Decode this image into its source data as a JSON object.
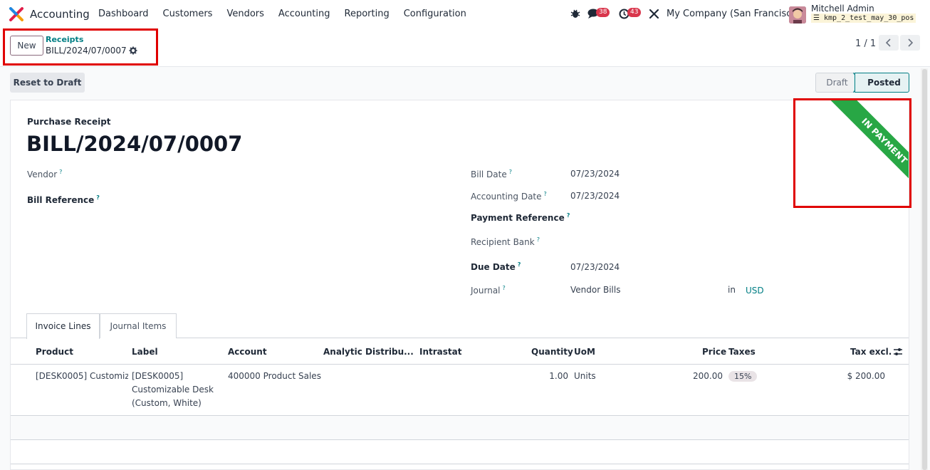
{
  "navbar": {
    "app_name": "Accounting",
    "menu": [
      "Dashboard",
      "Customers",
      "Vendors",
      "Accounting",
      "Reporting",
      "Configuration"
    ],
    "messages_count": "38",
    "activities_count": "43",
    "company": "My Company (San Francisco)",
    "user_name": "Mitchell Admin",
    "database": "kmp_2_test_may_30_pos"
  },
  "control_panel": {
    "new_label": "New",
    "breadcrumb_parent": "Receipts",
    "breadcrumb_current": "BILL/2024/07/0007",
    "pager_value": "1 / 1"
  },
  "statusbar": {
    "reset_label": "Reset to Draft",
    "stages": [
      "Draft",
      "Posted"
    ],
    "current_stage": "Posted"
  },
  "form": {
    "ribbon": "IN PAYMENT",
    "record_type": "Purchase Receipt",
    "record_name": "BILL/2024/07/0007",
    "vendor_label": "Vendor",
    "bill_reference_label": "Bill Reference",
    "bill_date_label": "Bill Date",
    "bill_date": "07/23/2024",
    "accounting_date_label": "Accounting Date",
    "accounting_date": "07/23/2024",
    "payment_reference_label": "Payment Reference",
    "recipient_bank_label": "Recipient Bank",
    "due_date_label": "Due Date",
    "due_date": "07/23/2024",
    "journal_label": "Journal",
    "journal": "Vendor Bills",
    "in_label": "in",
    "currency": "USD",
    "help_mark": "?"
  },
  "tabs": [
    "Invoice Lines",
    "Journal Items"
  ],
  "lines_table": {
    "headers": [
      "Product",
      "Label",
      "Account",
      "Analytic Distribu...",
      "Intrastat",
      "Quantity",
      "UoM",
      "Price",
      "Taxes",
      "Tax excl."
    ],
    "rows": [
      {
        "product": "[DESK0005] Customiza",
        "label_1": "[DESK0005]",
        "label_2": "Customizable Desk",
        "label_3": "(Custom, White)",
        "account": "400000 Product Sales",
        "quantity": "1.00",
        "uom": "Units",
        "price": "200.00",
        "taxes": "15%",
        "tax_excl": "$ 200.00"
      }
    ]
  },
  "colors": {
    "accent": "#017e84",
    "ribbon_green": "#28a745",
    "highlight_red": "#e00000",
    "badge_red": "#d9364c"
  }
}
